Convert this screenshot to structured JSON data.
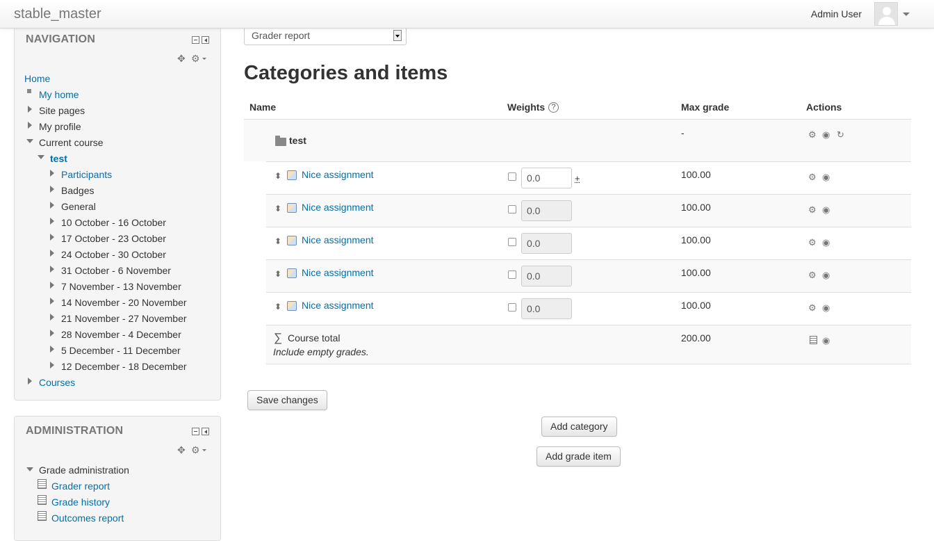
{
  "navbar": {
    "site_name": "stable_master",
    "user_name": "Admin User"
  },
  "navigation_block": {
    "title": "NAVIGATION",
    "items": [
      {
        "label": "Home"
      },
      {
        "label": "My home"
      },
      {
        "label": "Site pages"
      },
      {
        "label": "My profile"
      },
      {
        "label": "Current course"
      },
      {
        "label": "test"
      },
      {
        "label": "Participants"
      },
      {
        "label": "Badges"
      },
      {
        "label": "General"
      },
      {
        "label": "10 October - 16 October"
      },
      {
        "label": "17 October - 23 October"
      },
      {
        "label": "24 October - 30 October"
      },
      {
        "label": "31 October - 6 November"
      },
      {
        "label": "7 November - 13 November"
      },
      {
        "label": "14 November - 20 November"
      },
      {
        "label": "21 November - 27 November"
      },
      {
        "label": "28 November - 4 December"
      },
      {
        "label": "5 December - 11 December"
      },
      {
        "label": "12 December - 18 December"
      },
      {
        "label": "Courses"
      }
    ]
  },
  "administration_block": {
    "title": "ADMINISTRATION",
    "items": [
      {
        "label": "Grade administration"
      },
      {
        "label": "Grader report"
      },
      {
        "label": "Grade history"
      },
      {
        "label": "Outcomes report"
      }
    ]
  },
  "report_select": {
    "value": "Grader report"
  },
  "page_title": "Categories and items",
  "table": {
    "headers": {
      "name": "Name",
      "weights": "Weights",
      "max_grade": "Max grade",
      "actions": "Actions"
    },
    "category": {
      "name": "test",
      "max_grade": "-"
    },
    "items": [
      {
        "name": "Nice assignment",
        "weight": "0.0",
        "max_grade": "100.00"
      },
      {
        "name": "Nice assignment",
        "weight": "0.0",
        "max_grade": "100.00"
      },
      {
        "name": "Nice assignment",
        "weight": "0.0",
        "max_grade": "100.00"
      },
      {
        "name": "Nice assignment",
        "weight": "0.0",
        "max_grade": "100.00"
      },
      {
        "name": "Nice assignment",
        "weight": "0.0",
        "max_grade": "100.00"
      }
    ],
    "weight_plus": "+",
    "total": {
      "name": "Course total",
      "note": "Include empty grades.",
      "max_grade": "200.00"
    }
  },
  "buttons": {
    "save": "Save changes",
    "add_category": "Add category",
    "add_grade_item": "Add grade item"
  },
  "icons": {
    "gear": "gear-icon",
    "eye": "eye-icon",
    "reset": "reset-icon",
    "move": "move-icon",
    "calculator": "calculator-icon"
  },
  "colors": {
    "link": "#0070a8",
    "text": "#333333",
    "block_title": "#777777"
  }
}
